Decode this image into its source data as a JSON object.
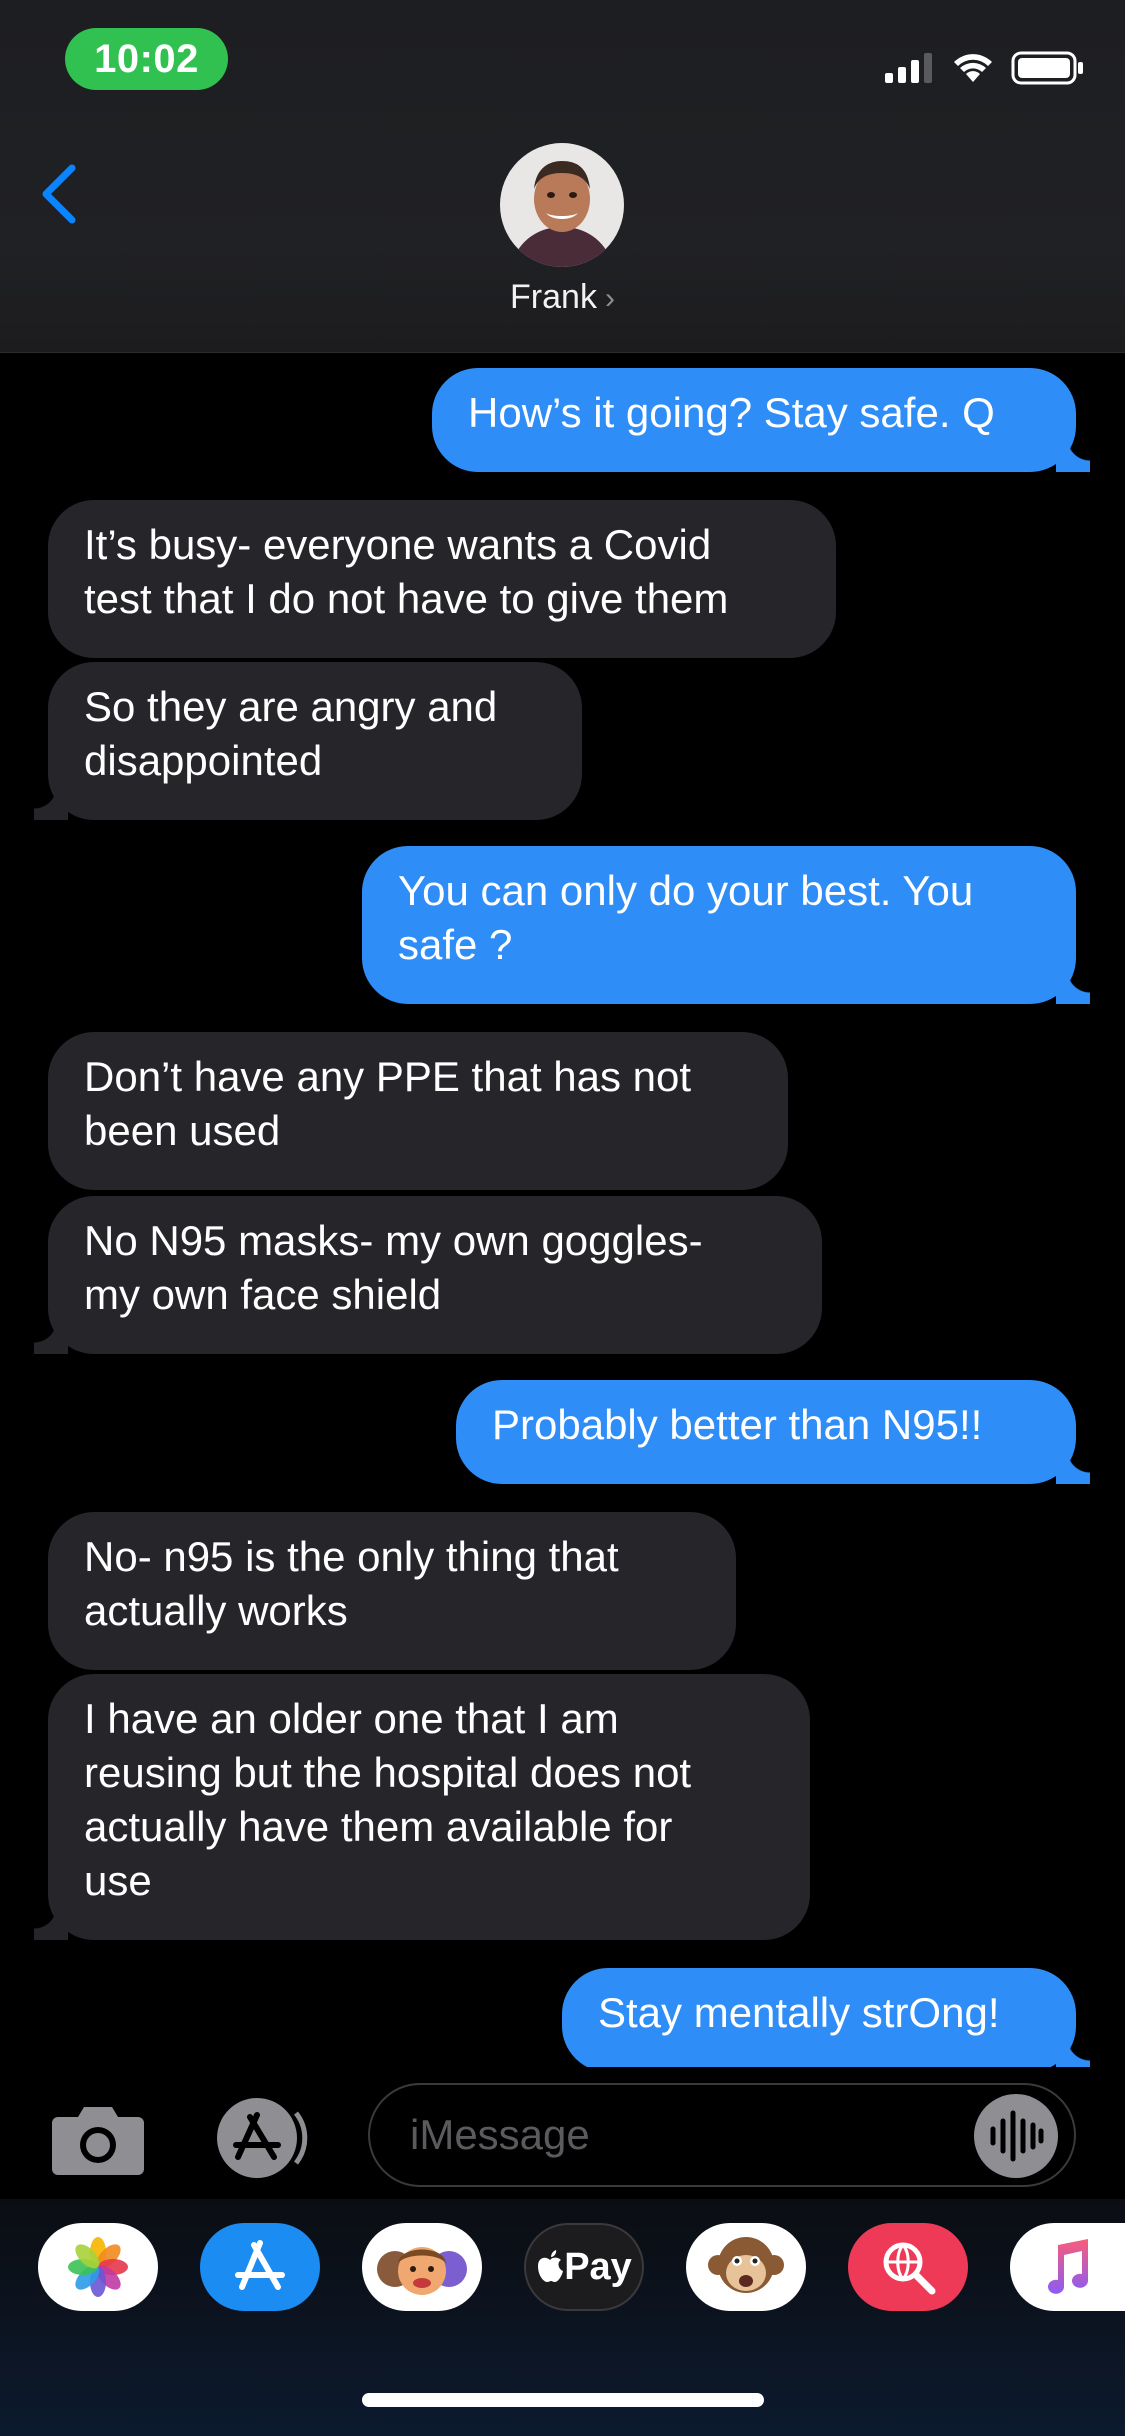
{
  "status_bar": {
    "time": "10:02"
  },
  "header": {
    "contact_name": "Frank",
    "contact_chevron": "›"
  },
  "messages": [
    {
      "direction": "sent",
      "text": "How’s it going? Stay safe. Q"
    },
    {
      "direction": "received",
      "text": "It’s busy- everyone wants a Covid\ntest that I do not have to give them"
    },
    {
      "direction": "received",
      "text": "So they are angry and\ndisappointed"
    },
    {
      "direction": "sent",
      "text": "You can only do your best. You\nsafe ?"
    },
    {
      "direction": "received",
      "text": "Don’t have any PPE that has not\nbeen used"
    },
    {
      "direction": "received",
      "text": "No N95 masks- my own goggles-\nmy own face shield"
    },
    {
      "direction": "sent",
      "text": "Probably better than N95!!"
    },
    {
      "direction": "received",
      "text": "No- n95 is the only thing that\nactually works"
    },
    {
      "direction": "received",
      "text": "I have an older one that I am\nreusing but the hospital does not\nactually have them available for\nuse"
    },
    {
      "direction": "sent",
      "text": "Stay mentally strOng!"
    }
  ],
  "composer": {
    "placeholder": "iMessage"
  },
  "app_drawer": {
    "apps": [
      {
        "icon": "photos-icon"
      },
      {
        "icon": "app-store-icon"
      },
      {
        "icon": "memoji-stickers-icon"
      },
      {
        "icon": "apple-pay-icon",
        "label": "Pay"
      },
      {
        "icon": "animoji-monkey-icon"
      },
      {
        "icon": "image-search-icon"
      },
      {
        "icon": "music-icon"
      }
    ]
  },
  "colors": {
    "sent_bubble": "#2f8df7",
    "received_bubble": "#26252a",
    "accent": "#0a84ff",
    "clock_pill": "#30c150"
  }
}
